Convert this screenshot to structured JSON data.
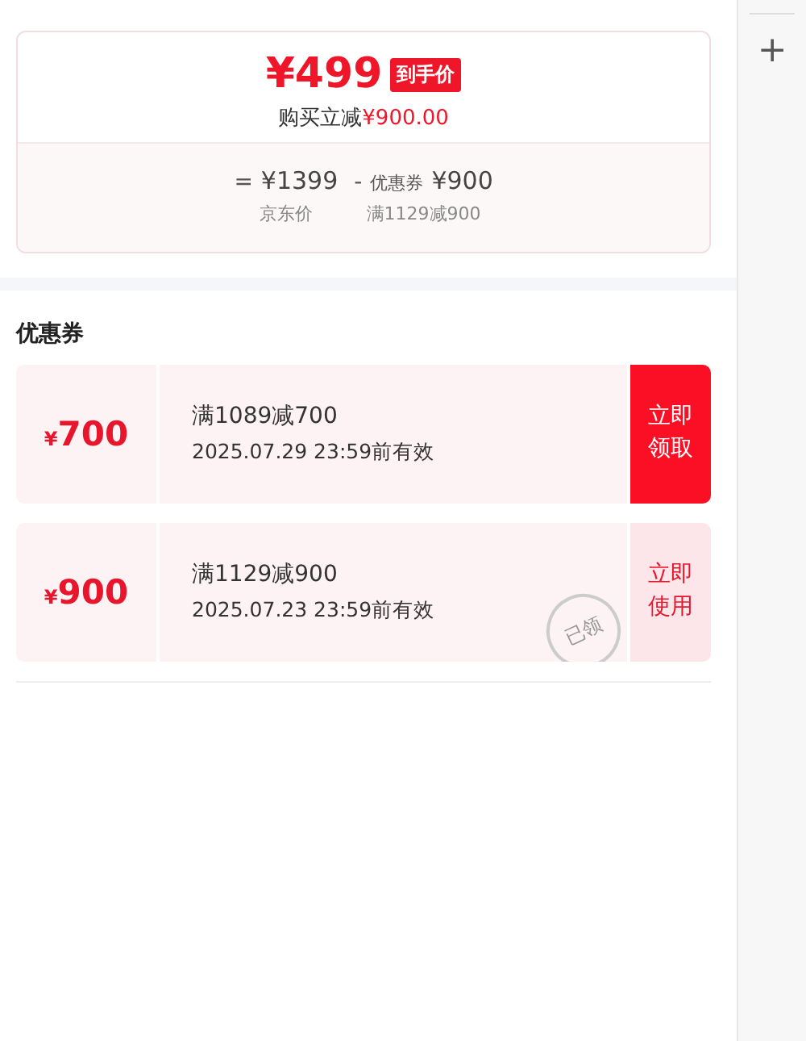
{
  "price_card": {
    "final_price": "¥499",
    "final_tag": "到手价",
    "saving_label": "购买立减",
    "saving_amount": "¥900.00",
    "formula": [
      {
        "kind": "value",
        "sign": "=",
        "amount": "¥1399",
        "caption": "京东价"
      },
      {
        "kind": "value",
        "sign": "-",
        "prefix": "优惠券",
        "amount": "¥900",
        "caption": "满1129减900"
      }
    ]
  },
  "sidebar": {
    "add_icon": "+"
  },
  "coupons": {
    "title": "优惠券",
    "items": [
      {
        "currency": "¥",
        "amount": "700",
        "condition": "满1089减700",
        "validity": "2025.07.29 23:59前有效",
        "action": "立即领取",
        "claimed": false
      },
      {
        "currency": "¥",
        "amount": "900",
        "condition": "满1129减900",
        "validity": "2025.07.23 23:59前有效",
        "action": "立即使用",
        "claimed": true,
        "stamp": "已领"
      }
    ]
  }
}
